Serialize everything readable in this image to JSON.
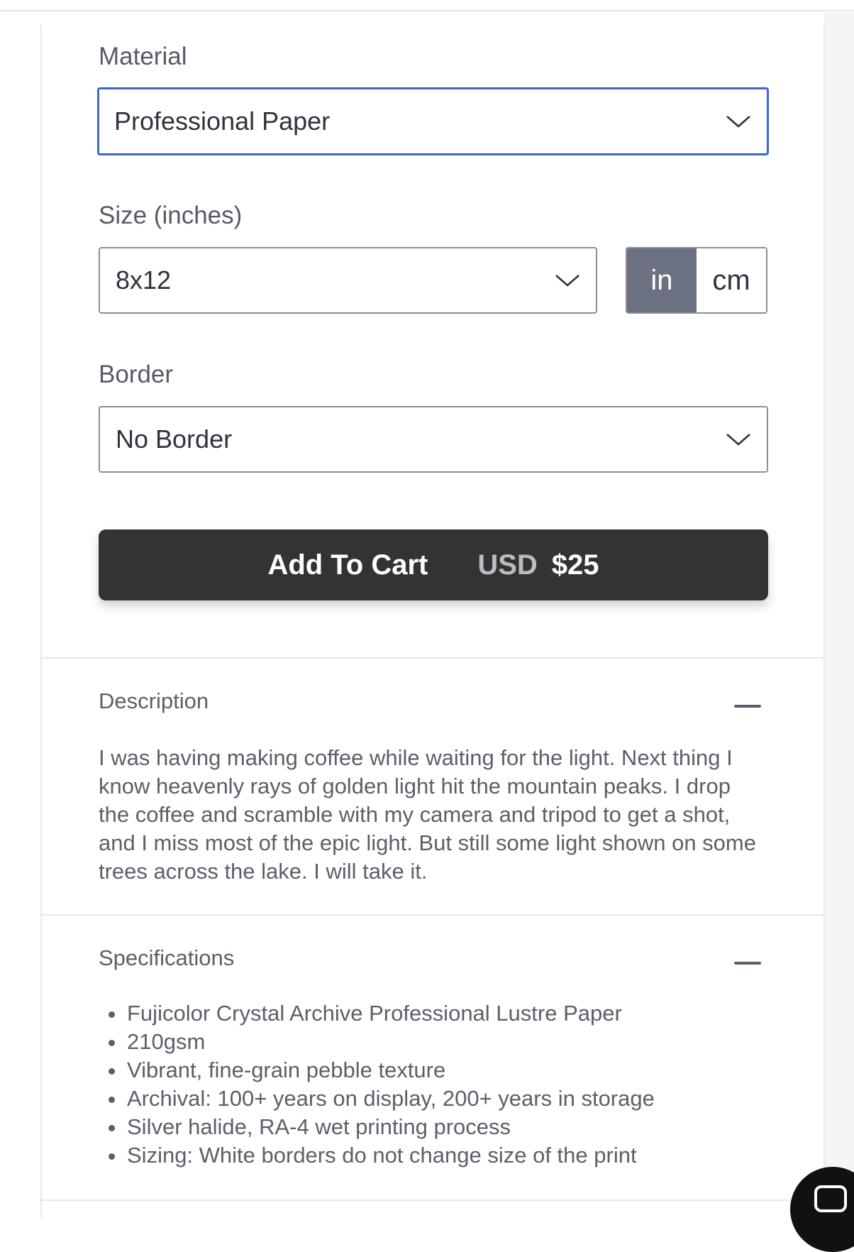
{
  "material": {
    "label": "Material",
    "selected": "Professional Paper"
  },
  "size": {
    "label": "Size (inches)",
    "selected": "8x12",
    "units": [
      "in",
      "cm"
    ],
    "active_unit": "in"
  },
  "border": {
    "label": "Border",
    "selected": "No Border"
  },
  "cart": {
    "button_label": "Add To Cart",
    "currency": "USD",
    "price": "$25"
  },
  "description": {
    "title": "Description",
    "text": "I was having making coffee while waiting for the light. Next thing I know heavenly rays of golden light hit the mountain peaks. I drop the coffee and scramble with my camera and tripod to get a shot, and I miss most of the epic light. But still some light shown on some trees across the lake. I will take it."
  },
  "specifications": {
    "title": "Specifications",
    "items": [
      "Fujicolor Crystal Archive Professional Lustre Paper",
      "210gsm",
      "Vibrant, fine-grain pebble texture",
      "Archival: 100+ years on display, 200+ years in storage",
      "Silver halide, RA-4 wet printing process",
      "Sizing: White borders do not change size of the print"
    ]
  },
  "icons": {
    "select_chevron": "chevron-down-icon",
    "collapse": "minus-icon",
    "chat": "chat-icon"
  },
  "colors": {
    "focus_border": "#3e66cf",
    "cart_button": "#333333",
    "active_unit_bg": "#6b7180"
  }
}
